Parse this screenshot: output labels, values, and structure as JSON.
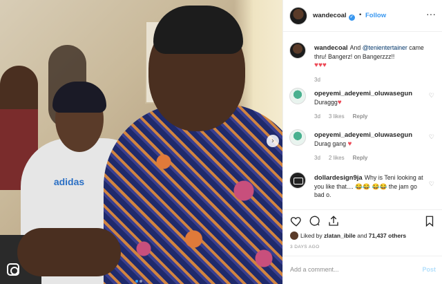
{
  "post": {
    "author": "wandecoal",
    "follow_label": "Follow",
    "dot_sep": "•"
  },
  "caption": {
    "username": "wandecoal",
    "text_before": "And ",
    "mention": "@tenientertainer",
    "text_after": " came thru! Bangerz! on Bangerzzz!!",
    "hearts": "♥♥♥",
    "age": "3d"
  },
  "comments": [
    {
      "username": "opeyemi_adeyemi_oluwasegun",
      "text": "Duraggg",
      "heart": "♥",
      "age": "3d",
      "likes": "3 likes",
      "reply": "Reply"
    },
    {
      "username": "opeyemi_adeyemi_oluwasegun",
      "text": "Durag gang",
      "heart": "♥",
      "age": "3d",
      "likes": "2 likes",
      "reply": "Reply"
    },
    {
      "username": "dollardesign9ja",
      "text": "Why is Teni looking at you like that.... 😂😂 😂😂 the jam go bad o."
    }
  ],
  "likes": {
    "prefix": "Liked by ",
    "user": "zlatan_ibile",
    "middle": " and ",
    "count": "71,437 others"
  },
  "date": "3 DAYS AGO",
  "add_comment": {
    "placeholder": "Add a comment...",
    "post_label": "Post"
  },
  "photo": {
    "shirt_logo": "adidas",
    "carousel_dots": 2,
    "active_dot": 0
  },
  "colors": {
    "link_blue": "#3897f0",
    "heart_red": "#ed4956",
    "muted": "#8e8e8e"
  }
}
